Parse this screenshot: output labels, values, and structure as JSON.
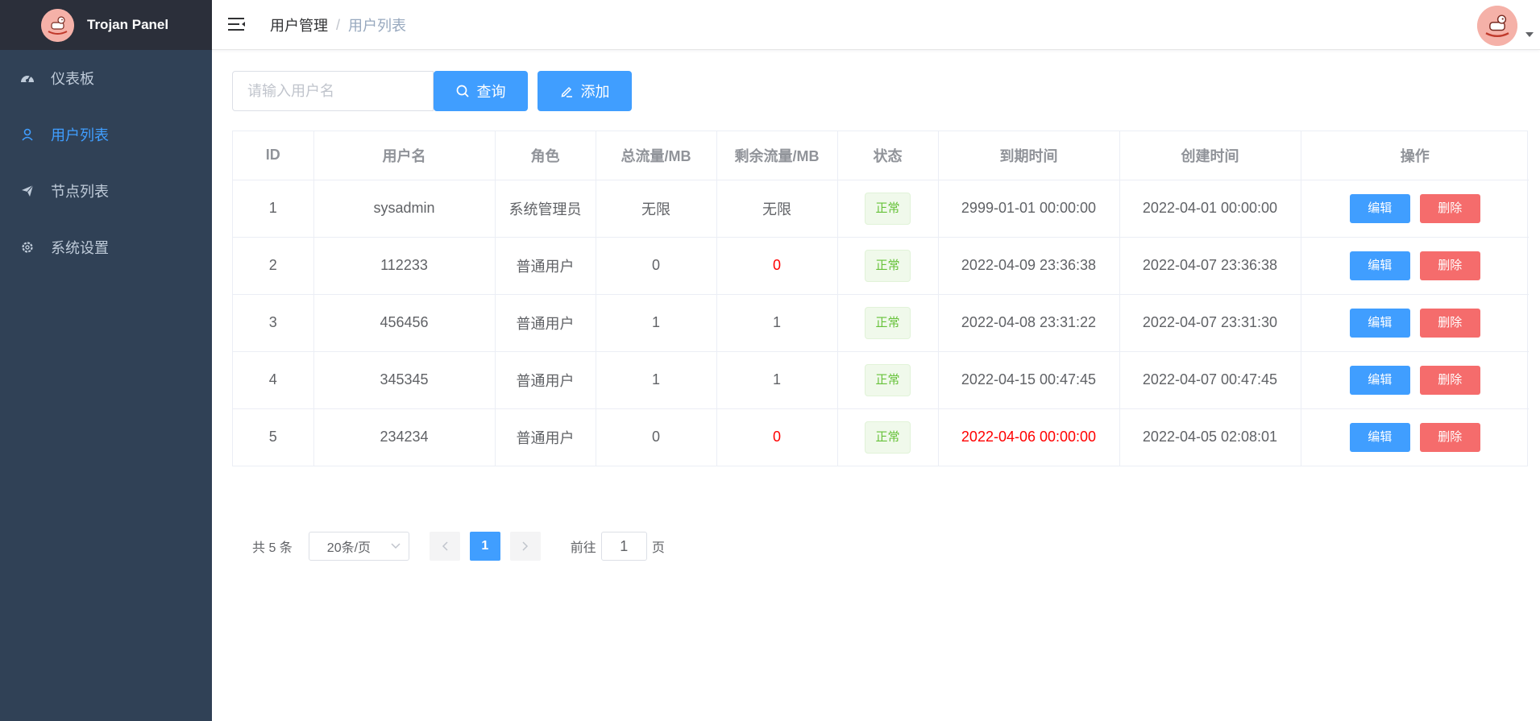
{
  "app": {
    "title": "Trojan Panel"
  },
  "sidebar": {
    "items": [
      {
        "label": "仪表板",
        "icon": "dashboard-icon"
      },
      {
        "label": "用户列表",
        "icon": "user-icon"
      },
      {
        "label": "节点列表",
        "icon": "paper-plane-icon"
      },
      {
        "label": "系统设置",
        "icon": "gear-icon"
      }
    ],
    "active_index": 1
  },
  "header": {
    "breadcrumb": [
      "用户管理",
      "用户列表"
    ],
    "breadcrumb_separator": "/"
  },
  "toolbar": {
    "search_placeholder": "请输入用户名",
    "search_value": "",
    "query_label": "查询",
    "add_label": "添加"
  },
  "table": {
    "columns": [
      "ID",
      "用户名",
      "角色",
      "总流量/MB",
      "剩余流量/MB",
      "状态",
      "到期时间",
      "创建时间",
      "操作"
    ],
    "rows": [
      {
        "id": "1",
        "username": "sysadmin",
        "role": "系统管理员",
        "quota": "无限",
        "remaining": "无限",
        "remaining_warn": false,
        "status": "正常",
        "expire": "2999-01-01 00:00:00",
        "expire_warn": false,
        "created": "2022-04-01 00:00:00"
      },
      {
        "id": "2",
        "username": "112233",
        "role": "普通用户",
        "quota": "0",
        "remaining": "0",
        "remaining_warn": true,
        "status": "正常",
        "expire": "2022-04-09 23:36:38",
        "expire_warn": false,
        "created": "2022-04-07 23:36:38"
      },
      {
        "id": "3",
        "username": "456456",
        "role": "普通用户",
        "quota": "1",
        "remaining": "1",
        "remaining_warn": false,
        "status": "正常",
        "expire": "2022-04-08 23:31:22",
        "expire_warn": false,
        "created": "2022-04-07 23:31:30"
      },
      {
        "id": "4",
        "username": "345345",
        "role": "普通用户",
        "quota": "1",
        "remaining": "1",
        "remaining_warn": false,
        "status": "正常",
        "expire": "2022-04-15 00:47:45",
        "expire_warn": false,
        "created": "2022-04-07 00:47:45"
      },
      {
        "id": "5",
        "username": "234234",
        "role": "普通用户",
        "quota": "0",
        "remaining": "0",
        "remaining_warn": true,
        "status": "正常",
        "expire": "2022-04-06 00:00:00",
        "expire_warn": true,
        "created": "2022-04-05 02:08:01"
      }
    ],
    "edit_label": "编辑",
    "delete_label": "删除"
  },
  "pagination": {
    "total_text": "共 5 条",
    "page_size": "20条/页",
    "current_page": "1",
    "jump_prefix": "前往",
    "jump_value": "1",
    "jump_suffix": "页"
  },
  "colors": {
    "sidebar_bg": "#304156",
    "logo_bg": "#2b2f3a",
    "primary": "#409eff",
    "danger_button": "#f56c6c",
    "warning_text": "#ff0000",
    "success_tag": "#67c23a"
  }
}
